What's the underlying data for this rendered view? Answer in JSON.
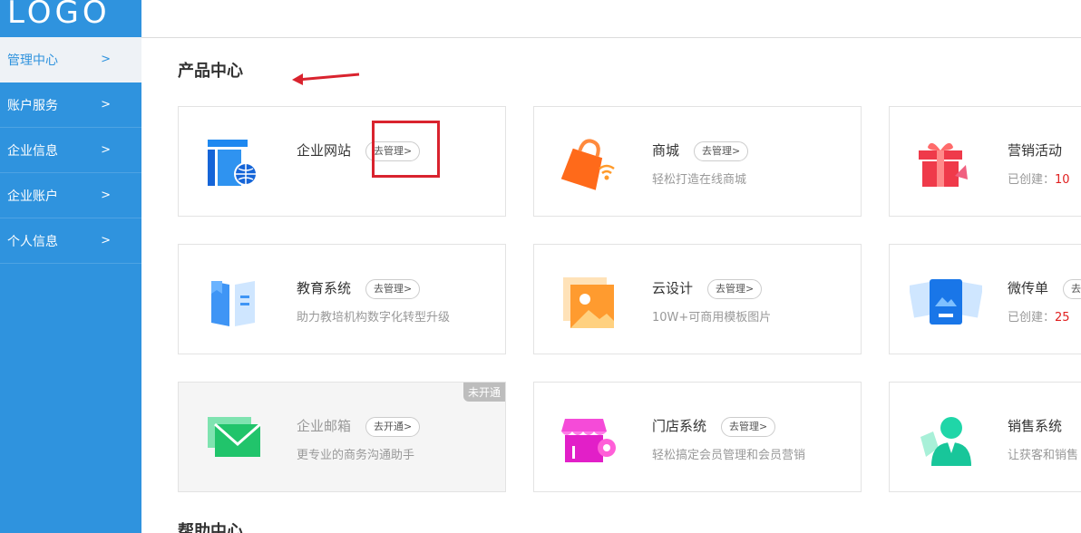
{
  "logo": "LOGO",
  "sidebar": {
    "items": [
      {
        "label": "管理中心",
        "chevron": ">"
      },
      {
        "label": "账户服务",
        "chevron": ">"
      },
      {
        "label": "企业信息",
        "chevron": ">"
      },
      {
        "label": "企业账户",
        "chevron": ">"
      },
      {
        "label": "个人信息",
        "chevron": ">"
      }
    ]
  },
  "main": {
    "section_title": "产品中心",
    "help_title": "帮助中心",
    "cards": [
      {
        "title": "企业网站",
        "action": "去管理>",
        "desc": "",
        "icon": "website-icon"
      },
      {
        "title": "商城",
        "action": "去管理>",
        "desc": "轻松打造在线商城",
        "icon": "shop-bag-icon"
      },
      {
        "title": "营销活动",
        "action": "",
        "desc_prefix": "已创建：",
        "desc_num": "10",
        "icon": "gift-icon"
      },
      {
        "title": "教育系统",
        "action": "去管理>",
        "desc": "助力教培机构数字化转型升级",
        "icon": "book-icon"
      },
      {
        "title": "云设计",
        "action": "去管理>",
        "desc": "10W+可商用模板图片",
        "icon": "image-icon"
      },
      {
        "title": "微传单",
        "action": "去",
        "desc_prefix": "已创建：",
        "desc_num": "25",
        "icon": "flyer-icon"
      },
      {
        "title": "企业邮箱",
        "action": "去开通>",
        "desc": "更专业的商务沟通助手",
        "badge": "未开通",
        "icon": "mail-icon"
      },
      {
        "title": "门店系统",
        "action": "去管理>",
        "desc": "轻松搞定会员管理和会员营销",
        "icon": "store-icon"
      },
      {
        "title": "销售系统",
        "action": "",
        "desc": "让获客和销售",
        "icon": "sales-person-icon"
      }
    ]
  },
  "colors": {
    "sidebar": "#2f93de",
    "accent_red": "#d9232e"
  }
}
